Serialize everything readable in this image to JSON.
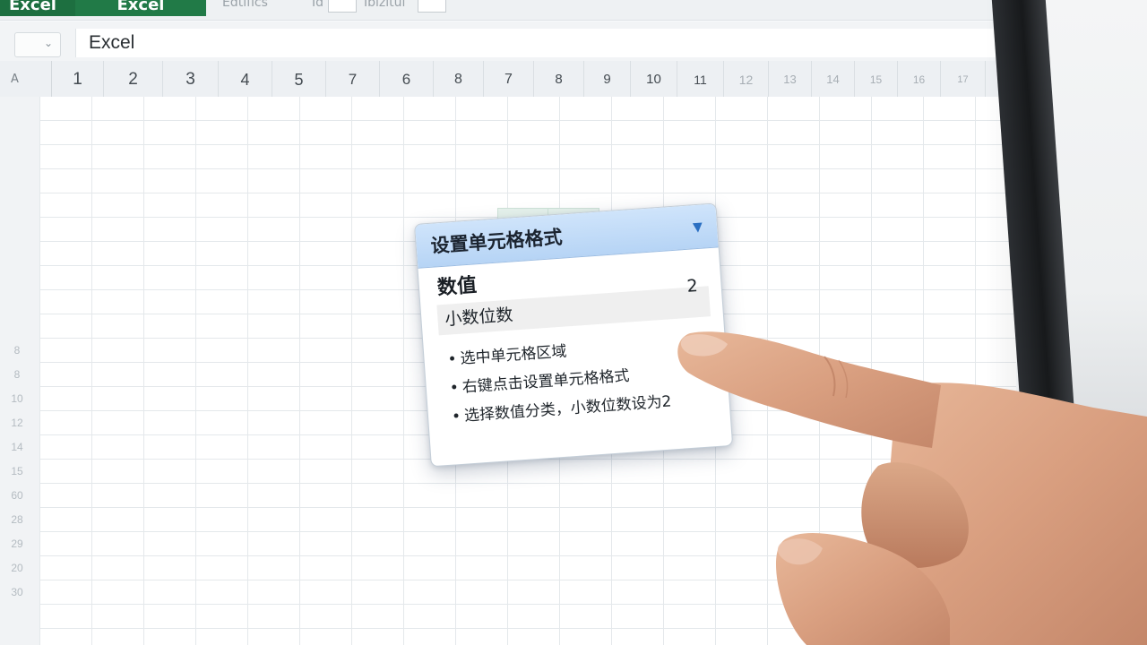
{
  "ribbon": {
    "tab_1": "Excel",
    "tab_2": "Excel",
    "label_1": "Edtifics",
    "label_2": "Id",
    "label_3": "Iblzitul"
  },
  "formula_bar": {
    "content": "Excel"
  },
  "corner_label": "A",
  "column_headers": [
    "1",
    "2",
    "3",
    "4",
    "5",
    "7",
    "6",
    "8",
    "7",
    "8",
    "9",
    "10",
    "11",
    "12",
    "13",
    "14",
    "15",
    "16",
    "17"
  ],
  "row_headers": [
    "",
    "",
    "",
    "",
    "",
    "",
    "",
    "",
    "",
    "",
    "8",
    "8",
    "10",
    "12",
    "14",
    "15",
    "60",
    "28",
    "29",
    "20",
    "30"
  ],
  "dialog": {
    "title": "设置单元格格式",
    "section": "数值",
    "field_label": "小数位数",
    "field_value": "2",
    "steps": [
      "选中单元格区域",
      "右键点击设置单元格格式",
      "选择数值分类，小数位数设为2"
    ]
  },
  "colors": {
    "ribbon_green": "#217a47",
    "dialog_header": "#b6d4f5",
    "dialog_arrow": "#2a6fc2",
    "selected_cell": "#e6f2ec"
  },
  "icons": {
    "dropdown": "chevron-down-icon",
    "dialog_arrow": "triangle-down-icon"
  }
}
